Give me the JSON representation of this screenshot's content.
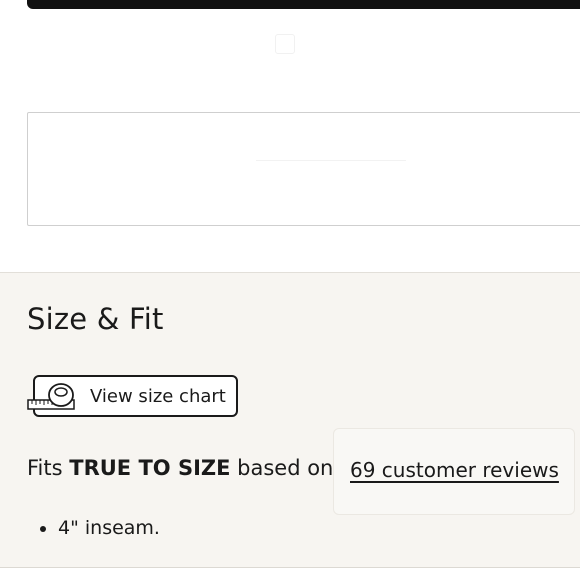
{
  "size_fit": {
    "title": "Size & Fit",
    "size_chart_button": {
      "label": "View size chart",
      "icon": "measuring-tape-icon"
    },
    "fit_prefix": "Fits ",
    "fit_emphasis": "TRUE TO SIZE",
    "fit_suffix": " based on",
    "reviews_link": "69 customer reviews",
    "details": [
      "4\" inseam."
    ]
  },
  "colors": {
    "section_bg": "#f7f5f1",
    "text": "#1a1a1a",
    "top_bar": "#111111",
    "box_border": "#cfcfcf"
  }
}
